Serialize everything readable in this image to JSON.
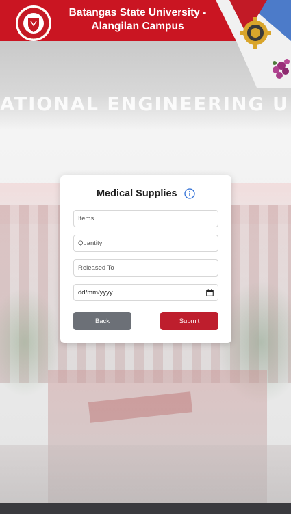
{
  "header": {
    "title_line1": "Batangas State University -",
    "title_line2": "Alangilan Campus",
    "background_color": "#ca1522",
    "logo_icon": "batangas-state-university-seal",
    "corner_icon": "college-of-engineering-gear-logo"
  },
  "background": {
    "building_sign_text": "ATIONAL ENGINEERING U"
  },
  "form": {
    "title": "Medical Supplies",
    "info_icon": "info-circle-icon",
    "items_placeholder": "Items",
    "quantity_placeholder": "Quantity",
    "released_to_placeholder": "Released To",
    "date_placeholder": "dd/mm/yyyy",
    "calendar_icon": "calendar-icon",
    "back_label": "Back",
    "submit_label": "Submit"
  },
  "colors": {
    "accent_red": "#be1e2d",
    "back_button": "#6c7077",
    "info_blue": "#2f6fd6",
    "footer_bar": "#3a3a3e"
  }
}
